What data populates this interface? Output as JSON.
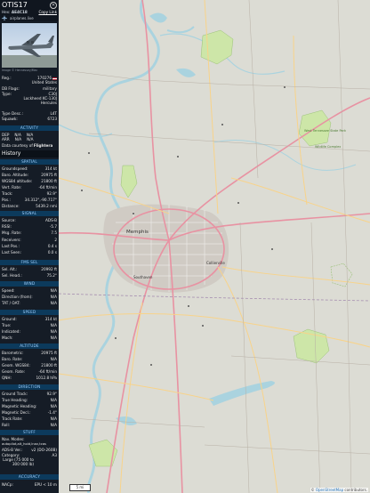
{
  "panel": {
    "callsign": "OTIS17",
    "close_glyph": "✕",
    "hex_label": "Hex:",
    "hex_value": "AE4C18",
    "copy_link": "Copy Link",
    "source": "airplanes.live",
    "photo_credit": "Image © Hennessey/Mac",
    "registration": {
      "label": "Reg.:",
      "value": "170276"
    },
    "country": "United States",
    "db_flags": {
      "label": "DB Flags:",
      "value": "military"
    },
    "type": {
      "label": "Type:",
      "value": "C30J"
    },
    "type_desc_full": "Lockheed KC-130J Hercules",
    "type_desc": {
      "label": "Type Desc.:",
      "value": "L4T"
    },
    "squawk": {
      "label": "Squawk:",
      "value": "6723"
    },
    "sections": {
      "activity": "ACTIVITY",
      "spatial": "SPATIAL",
      "signal": "SIGNAL",
      "fms": "FMS SEL",
      "wind": "WIND",
      "speed": "SPEED",
      "altitude": "ALTITUDE",
      "direction": "DIRECTION",
      "stuff": "STUFF",
      "accuracy": "ACCURACY"
    },
    "activity": {
      "dep_label": "DEP",
      "dep1": "N/A",
      "dep2": "N/A",
      "arr_label": "ARR",
      "arr1": "N/A",
      "arr2": "N/A",
      "courtesy": "Data courtesy of",
      "courtesy_src": "Flightera"
    },
    "history": "History",
    "spatial": [
      {
        "label": "Groundspeed:",
        "value": "314 kt"
      },
      {
        "label": "Baro. Altitude:",
        "value": "20975 ft"
      },
      {
        "label": "WGS84 altitude:",
        "value": "21800 ft"
      },
      {
        "label": "Vert. Rate:",
        "value": "-64 ft/min"
      },
      {
        "label": "Track:",
        "value": "92.9°"
      },
      {
        "label": "Pos.:",
        "value": "34.312°,-90.717°"
      },
      {
        "label": "Distance:",
        "value": "5439.2 nmi"
      }
    ],
    "signal": [
      {
        "label": "Source:",
        "value": "ADS-B"
      },
      {
        "label": "RSSI:",
        "value": "-5.7"
      },
      {
        "label": "Msg. Rate:",
        "value": "7.5"
      },
      {
        "label": "Receivers:",
        "value": "2"
      },
      {
        "label": "Last Pos.:",
        "value": "0.4 s"
      },
      {
        "label": "Last Seen:",
        "value": "0.0 s"
      }
    ],
    "fms": [
      {
        "label": "Sel. Alt.:",
        "value": "20992 ft"
      },
      {
        "label": "Sel. Head.:",
        "value": "75.2°"
      }
    ],
    "wind": [
      {
        "label": "Speed:",
        "value": "N/A"
      },
      {
        "label": "Direction (from):",
        "value": "N/A"
      },
      {
        "label": "TAT / OAT:",
        "value": "N/A"
      }
    ],
    "speed": [
      {
        "label": "Ground:",
        "value": "314 kt"
      },
      {
        "label": "True:",
        "value": "N/A"
      },
      {
        "label": "Indicated:",
        "value": "N/A"
      },
      {
        "label": "Mach:",
        "value": "N/A"
      }
    ],
    "altitude": [
      {
        "label": "Barometric:",
        "value": "20975 ft"
      },
      {
        "label": "Baro. Rate:",
        "value": "N/A"
      },
      {
        "label": "Geom. WGS84:",
        "value": "21800 ft"
      },
      {
        "label": "Geom. Rate:",
        "value": "-64 ft/min"
      },
      {
        "label": "QNH:",
        "value": "1012.8 hPa"
      }
    ],
    "direction": [
      {
        "label": "Ground Track:",
        "value": "92.9°"
      },
      {
        "label": "True Heading:",
        "value": "N/A"
      },
      {
        "label": "Magnetic Heading:",
        "value": "N/A"
      },
      {
        "label": "Magnetic Decl.:",
        "value": "-1.4°"
      },
      {
        "label": "Track Rate:",
        "value": "N/A"
      },
      {
        "label": "Roll:",
        "value": "N/A"
      }
    ],
    "stuff": {
      "nav_modes_label": "Nav. Modes:",
      "nav_modes": "autopilot,alt_hold,lnav,tcas",
      "ads_b_label": "ADS-B Ver.:",
      "ads_b_value": "v2 (DO-260B)",
      "category_label": "Category:",
      "category_value": "A3",
      "category_desc": "Large (75 000 to 300 000 lb)"
    },
    "accuracy": {
      "nac_label": "NACp:",
      "epu": "EPU < 10 m"
    }
  },
  "map": {
    "scale": "5 mi",
    "attribution_prefix": "© ",
    "attribution_link": "OpenStreetMap",
    "attribution_suffix": " contributors.",
    "cities": {
      "memphis": "Memphis",
      "southaven": "Southaven",
      "collierville": "Collierville"
    },
    "parks": {
      "tennessee_park": "West Tennessee State Park",
      "wildlife": "Wildlife Complex"
    },
    "colors": {
      "water": "#aad3df",
      "park": "#cde6a8",
      "motorway": "#e892a2",
      "primary": "#f8d38a",
      "land": "#dcdcd4"
    }
  }
}
